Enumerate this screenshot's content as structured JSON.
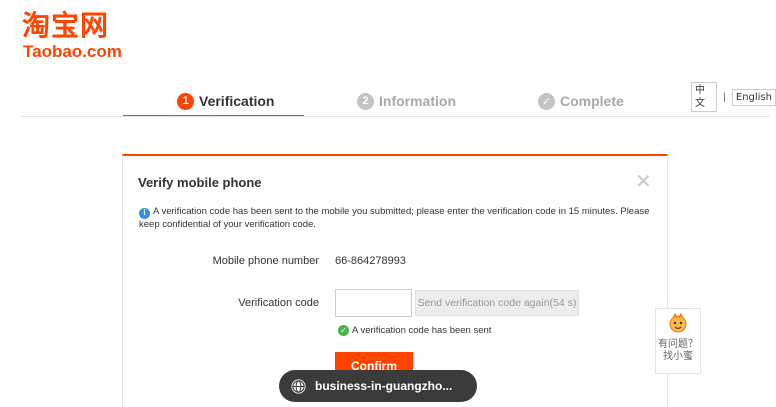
{
  "brand": {
    "name_cn": "淘宝网",
    "name_en": "Taobao.com",
    "accent_color": "#ff4400"
  },
  "steps": [
    {
      "number": "1",
      "label": "Verification",
      "state": "active"
    },
    {
      "number": "2",
      "label": "Information",
      "state": "inactive"
    },
    {
      "number": "✓",
      "label": "Complete",
      "state": "inactive"
    }
  ],
  "language": {
    "chinese": "中文",
    "separator": "|",
    "english": "English"
  },
  "panel": {
    "title": "Verify mobile phone",
    "close_icon": "close-icon",
    "notice": "A verification code has been sent to the mobile you submitted; please enter the verification code in 15 minutes. Please keep confidential of your verification code.",
    "phone_label": "Mobile phone number",
    "phone_value": "66-864278993",
    "code_label": "Verification code",
    "code_value": "",
    "resend_label": "Send verification code again(54 s)",
    "sent_status": "A verification code has been sent",
    "confirm_label": "Confirm"
  },
  "helper": {
    "line1": "有问题？",
    "line2": "找小蜜",
    "icon": "mascot-icon"
  },
  "url_pill": {
    "text": "business-in-guangzho...",
    "icon": "globe-icon"
  }
}
